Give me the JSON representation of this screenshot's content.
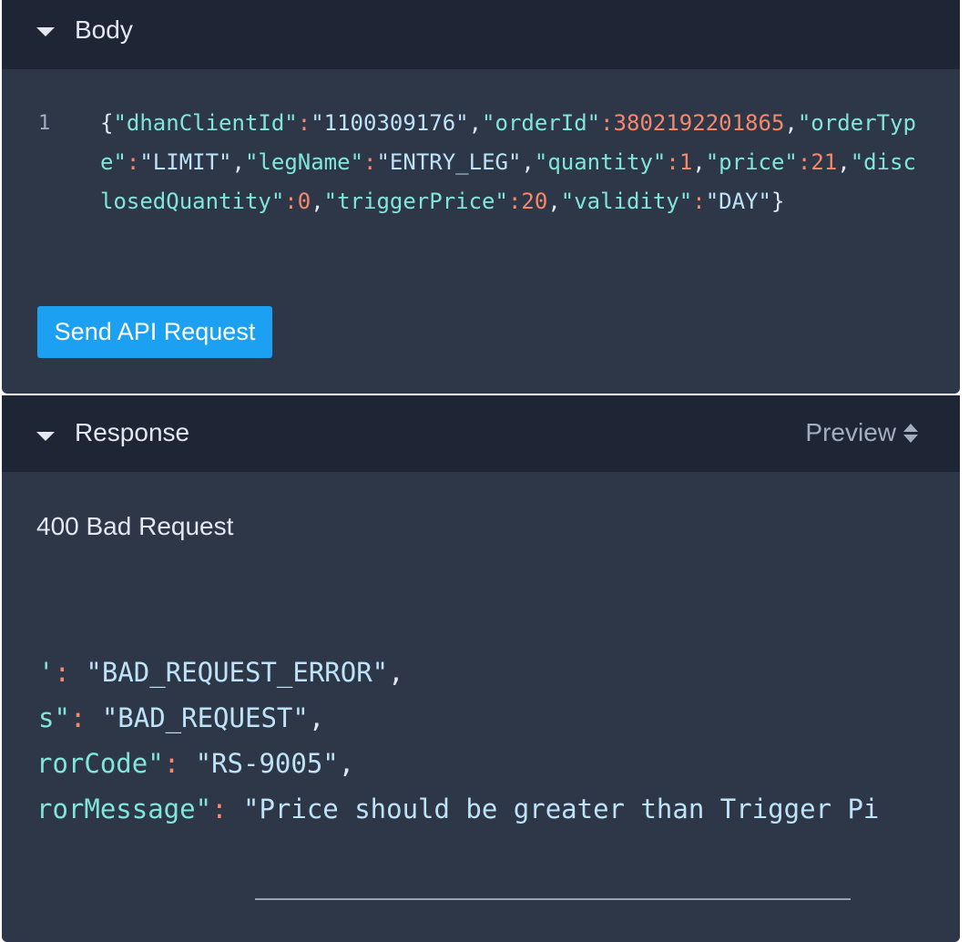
{
  "body_section": {
    "title": "Body",
    "line_number": "1",
    "request_json": {
      "k_dhanClientId": "\"dhanClientId\"",
      "v_dhanClientId": "\"1100309176\"",
      "k_orderId": "\"orderId\"",
      "v_orderId": "3802192201865",
      "k_orderType": "\"orderType\"",
      "v_orderType": "\"LIMIT\"",
      "k_legName": "\"legName\"",
      "v_legName": "\"ENTRY_LEG\"",
      "k_quantity": "\"quantity\"",
      "v_quantity": "1",
      "k_price": "\"price\"",
      "v_price": "21",
      "k_disclosedQuantity": "\"disclosedQuantity\"",
      "v_disclosedQuantity": "0",
      "k_triggerPrice": "\"triggerPrice\"",
      "v_triggerPrice": "20",
      "k_validity": "\"validity\"",
      "v_validity": "\"DAY\""
    },
    "send_button_label": "Send API Request"
  },
  "response_section": {
    "title": "Response",
    "view_mode": "Preview",
    "status": "400 Bad Request",
    "lines": [
      {
        "key_fragment": "'",
        "value": "\"BAD_REQUEST_ERROR\"",
        "tail": ","
      },
      {
        "key_fragment": "s\"",
        "value": "\"BAD_REQUEST\"",
        "tail": ","
      },
      {
        "key_fragment": "rorCode\"",
        "value": "\"RS-9005\"",
        "tail": ","
      },
      {
        "key_fragment": "rorMessage\"",
        "value": "\"Price should be greater than Trigger Pi",
        "tail": ""
      }
    ]
  },
  "colors": {
    "panel_bg": "#2d3748",
    "header_bg": "#1e2535",
    "button_bg": "#1ba0f2",
    "json_key": "#81e6d9",
    "json_string": "#bee3f8",
    "json_number": "#f6896b",
    "json_colon": "#f6896b"
  }
}
